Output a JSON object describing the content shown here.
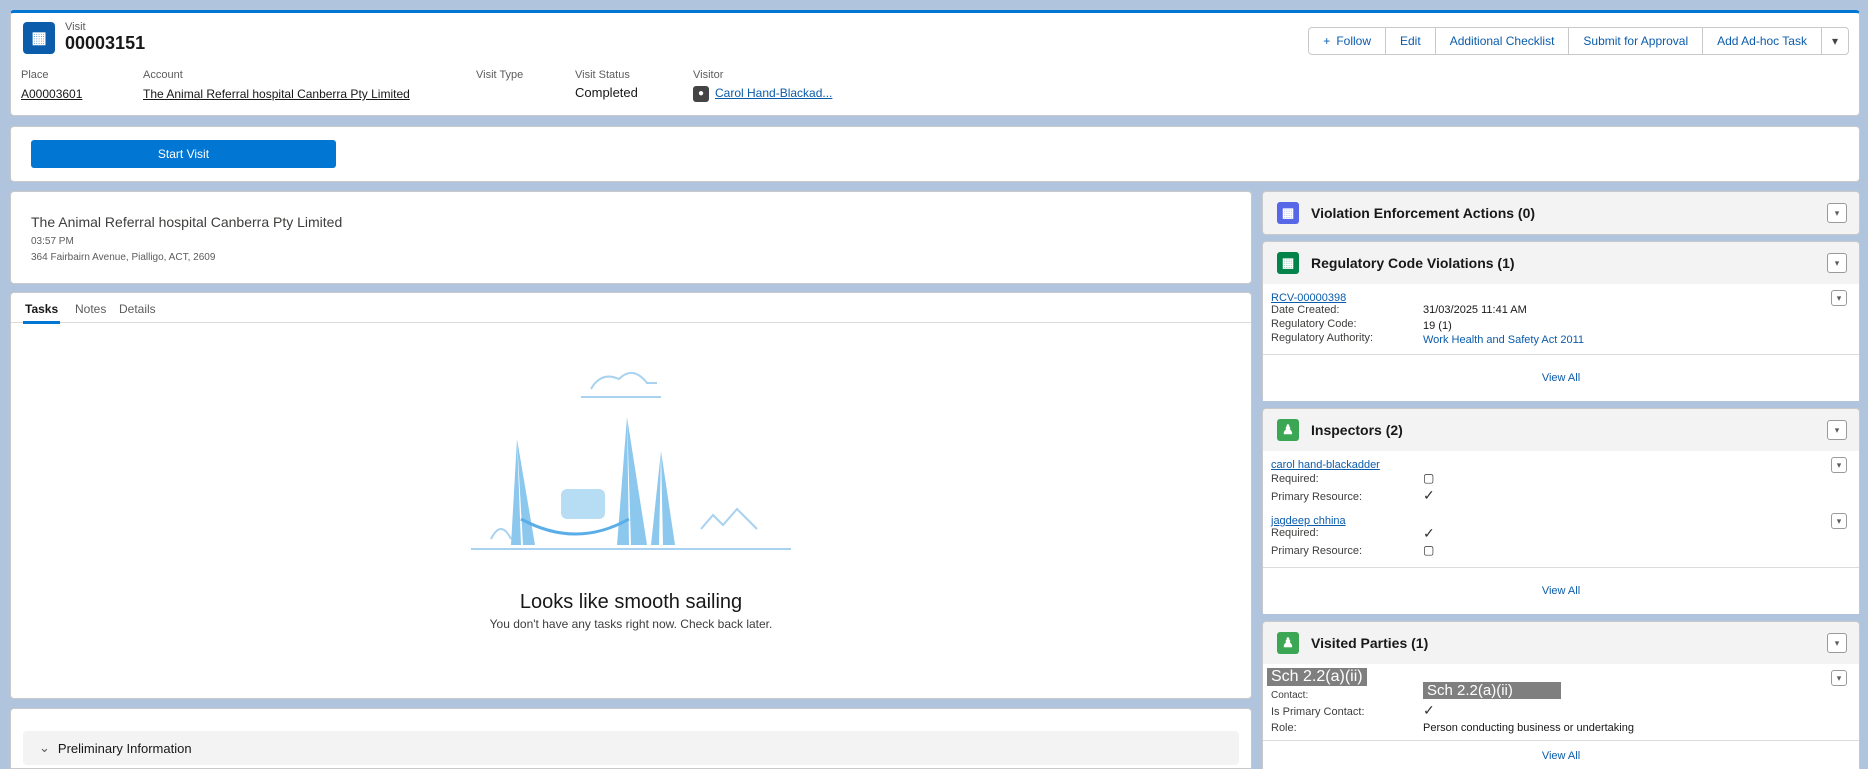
{
  "record": {
    "object_label": "Visit",
    "name": "00003151",
    "fields": [
      {
        "label": "Place",
        "value": "A00003601",
        "link": true
      },
      {
        "label": "Account",
        "value": "The Animal Referral hospital Canberra Pty Limited",
        "link": true
      },
      {
        "label": "Visit Type",
        "value": "",
        "link": false
      },
      {
        "label": "Visit Status",
        "value": "Completed",
        "link": false
      },
      {
        "label": "Visitor",
        "value": "Carol Hand-Blackad...",
        "link": true
      }
    ],
    "actions": {
      "follow": "Follow",
      "edit": "Edit",
      "additional_checklist": "Additional Checklist",
      "submit_for_approval": "Submit for Approval",
      "add_adhoc_task": "Add Ad-hoc Task"
    }
  },
  "start_visit": {
    "label": "Start Visit"
  },
  "account_info": {
    "name": "The Animal Referral hospital Canberra Pty Limited",
    "time": "03:57 PM",
    "address": "364 Fairbairn Avenue, Pialligo, ACT, 2609"
  },
  "tabs": {
    "items": [
      "Tasks",
      "Notes",
      "Details"
    ],
    "active": "Tasks",
    "empty_title": "Looks like smooth sailing",
    "empty_subtitle": "You don't have any tasks right now. Check back later."
  },
  "preliminary": {
    "label": "Preliminary Information"
  },
  "related": {
    "vea": {
      "title": "Violation Enforcement Actions (0)",
      "icon_color": "#5867e8"
    },
    "rcv": {
      "title": "Regulatory Code Violations (1)",
      "icon_color": "#04844b",
      "record_name": "RCV-00000398",
      "rows": [
        {
          "label": "Date Created:",
          "value": "31/03/2025 11:41 AM",
          "link": false
        },
        {
          "label": "Regulatory Code:",
          "value": "19 (1)",
          "link": false
        },
        {
          "label": "Regulatory Authority:",
          "value": "Work Health and Safety Act 2011",
          "link": true
        }
      ],
      "view_all": "View All"
    },
    "inspectors": {
      "title": "Inspectors (2)",
      "icon_color": "#3ba755",
      "items": [
        {
          "name": "carol hand-blackadder",
          "required_label": "Required:",
          "required": false,
          "primary_label": "Primary Resource:",
          "primary": true
        },
        {
          "name": "jagdeep chhina",
          "required_label": "Required:",
          "required": true,
          "primary_label": "Primary Resource:",
          "primary": false
        }
      ],
      "view_all": "View All"
    },
    "visited_parties": {
      "title": "Visited Parties (1)",
      "icon_color": "#3ba755",
      "redaction_1": "Sch 2.2(a)(ii)",
      "redaction_2": "Sch 2.2(a)(ii)",
      "contact_label": "Contact:",
      "is_primary_label": "Is Primary Contact:",
      "role_label": "Role:",
      "role_value": "Person conducting business or undertaking",
      "view_all": "View All"
    }
  }
}
